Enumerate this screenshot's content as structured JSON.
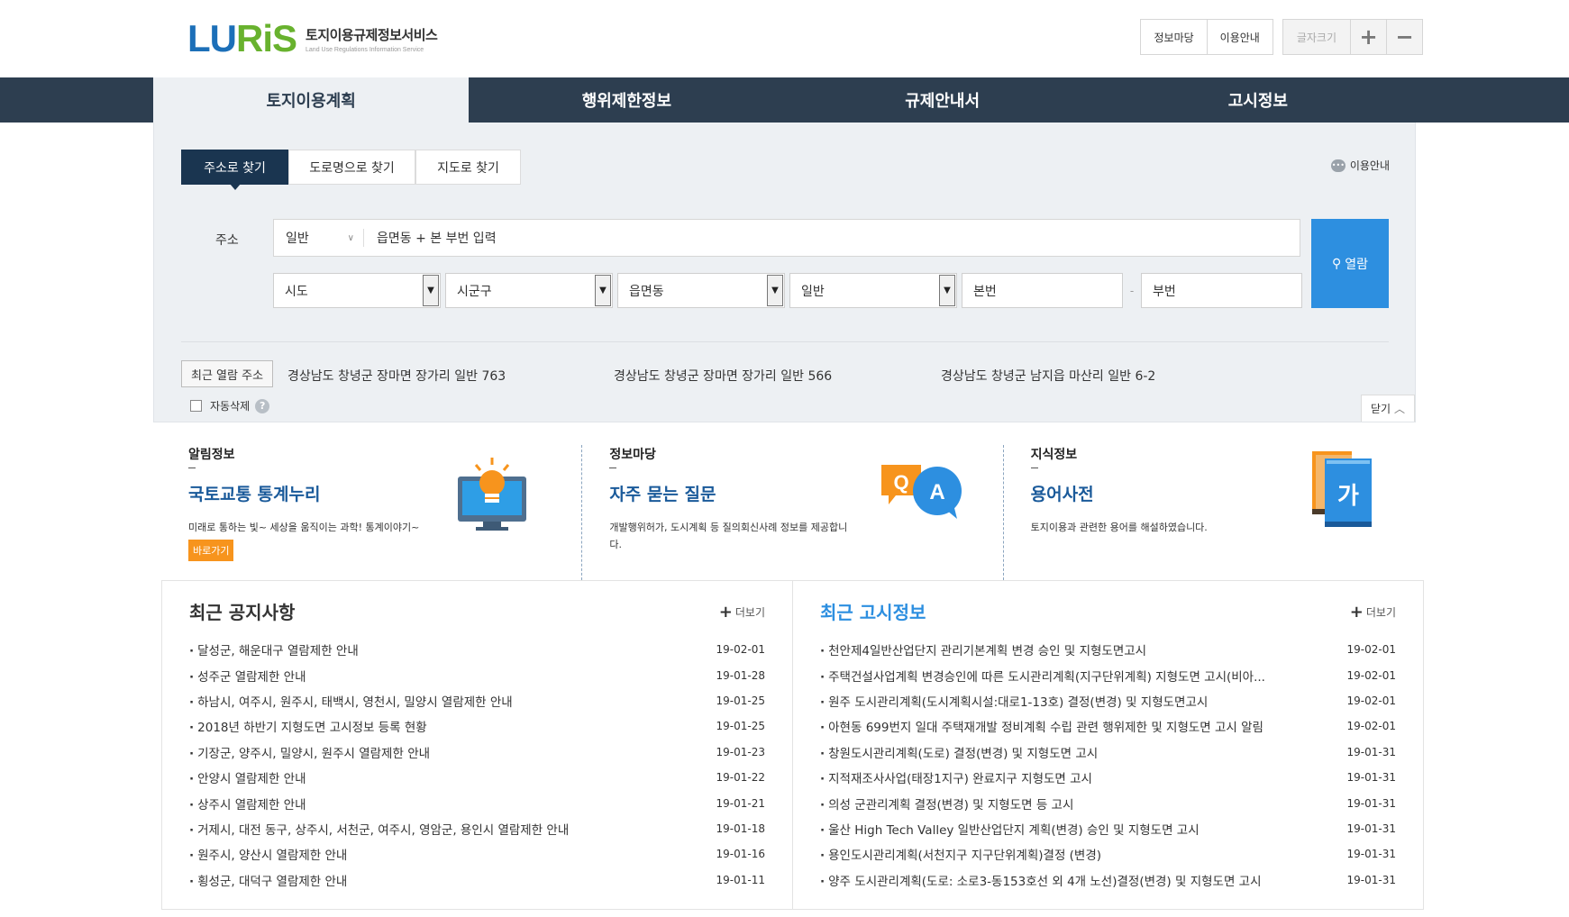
{
  "header": {
    "logo_mark_1": "LU",
    "logo_mark_2": "RiS",
    "logo_title": "토지이용규제정보서비스",
    "logo_sub": "Land Use Regulations Information Service",
    "util": [
      "정보마당",
      "이용안내"
    ],
    "font_size_label": "글자크기",
    "font_plus": "+",
    "font_minus": "−"
  },
  "nav": {
    "tabs": [
      "토지이용계획",
      "행위제한정보",
      "규제안내서",
      "고시정보"
    ]
  },
  "search": {
    "tabs": [
      "주소로 찾기",
      "도로명으로 찾기",
      "지도로 찾기"
    ],
    "guide_label": "이용안내",
    "address_label": "주소",
    "address_type": "일반",
    "address_placeholder": "읍면동 + 본 부번 입력",
    "selects": [
      "시도",
      "시군구",
      "읍면동",
      "일반"
    ],
    "main_no": "본번",
    "sub_no": "부번",
    "dash": "-",
    "view_button": "열람",
    "recent_button": "최근 열람 주소",
    "recent_items": [
      "경상남도 창녕군 장마면 장가리 일반 763",
      "경상남도 창녕군 장마면 장가리 일반 566",
      "경상남도 창녕군 남지읍 마산리 일반 6-2"
    ],
    "auto_delete": "자동삭제",
    "close": "닫기"
  },
  "info": [
    {
      "category": "알림정보",
      "title": "국토교통 통계누리",
      "desc": "미래로 통하는 빛~ 세상을 움직이는 과학! 통계이야기~",
      "go": "바로가기"
    },
    {
      "category": "정보마당",
      "title": "자주 묻는 질문",
      "desc": "개발행위허가, 도시계획 등 질의회신사례 정보를 제공합니다."
    },
    {
      "category": "지식정보",
      "title": "용어사전",
      "desc": "토지이용과 관련한 용어를 해설하였습니다."
    }
  ],
  "notices": {
    "title": "최근 공지사항",
    "more": "더보기",
    "items": [
      {
        "title": "달성군, 해운대구 열람제한 안내",
        "date": "19-02-01"
      },
      {
        "title": "성주군 열람제한 안내",
        "date": "19-01-28"
      },
      {
        "title": "하남시, 여주시, 원주시, 태백시, 영천시, 밀양시 열람제한 안내",
        "date": "19-01-25"
      },
      {
        "title": "2018년 하반기 지형도면 고시정보 등록 현황",
        "date": "19-01-25"
      },
      {
        "title": "기장군, 양주시, 밀양시, 원주시 열람제한 안내",
        "date": "19-01-23"
      },
      {
        "title": "안양시 열람제한 안내",
        "date": "19-01-22"
      },
      {
        "title": "상주시 열람제한 안내",
        "date": "19-01-21"
      },
      {
        "title": "거제시, 대전 동구, 상주시, 서천군, 여주시, 영암군, 용인시 열람제한 안내",
        "date": "19-01-18"
      },
      {
        "title": "원주시, 양산시 열람제한 안내",
        "date": "19-01-16"
      },
      {
        "title": "횡성군, 대덕구 열람제한 안내",
        "date": "19-01-11"
      }
    ]
  },
  "gosi": {
    "title": "최근 고시정보",
    "more": "더보기",
    "items": [
      {
        "title": "천안제4일반산업단지 관리기본계획 변경 승인 및 지형도면고시",
        "date": "19-02-01"
      },
      {
        "title": "주택건설사업계획 변경승인에 따른 도시관리계획(지구단위계획) 지형도면 고시(비아...",
        "date": "19-02-01"
      },
      {
        "title": "원주 도시관리계획(도시계획시설:대로1-13호) 결정(변경) 및 지형도면고시",
        "date": "19-02-01"
      },
      {
        "title": "아현동 699번지 일대 주택재개발 정비계획 수립 관련 행위제한 및 지형도면 고시 알림",
        "date": "19-02-01"
      },
      {
        "title": "창원도시관리계획(도로) 결정(변경) 및 지형도면 고시",
        "date": "19-01-31"
      },
      {
        "title": "지적재조사사업(태장1지구) 완료지구 지형도면 고시",
        "date": "19-01-31"
      },
      {
        "title": "의성 군관리계획 결정(변경) 및 지형도면 등 고시",
        "date": "19-01-31"
      },
      {
        "title": "울산 High Tech Valley 일반산업단지 계획(변경) 승인 및 지형도면 고시",
        "date": "19-01-31"
      },
      {
        "title": "용인도시관리계획(서천지구 지구단위계획)결정 (변경)",
        "date": "19-01-31"
      },
      {
        "title": "양주 도시관리계획(도로: 소로3-동153호선 외 4개 노선)결정(변경) 및 지형도면 고시",
        "date": "19-01-31"
      }
    ]
  },
  "colors": {
    "nav_bg": "#2d3e50",
    "accent_blue": "#2d8fe0",
    "orange": "#f7941d"
  }
}
